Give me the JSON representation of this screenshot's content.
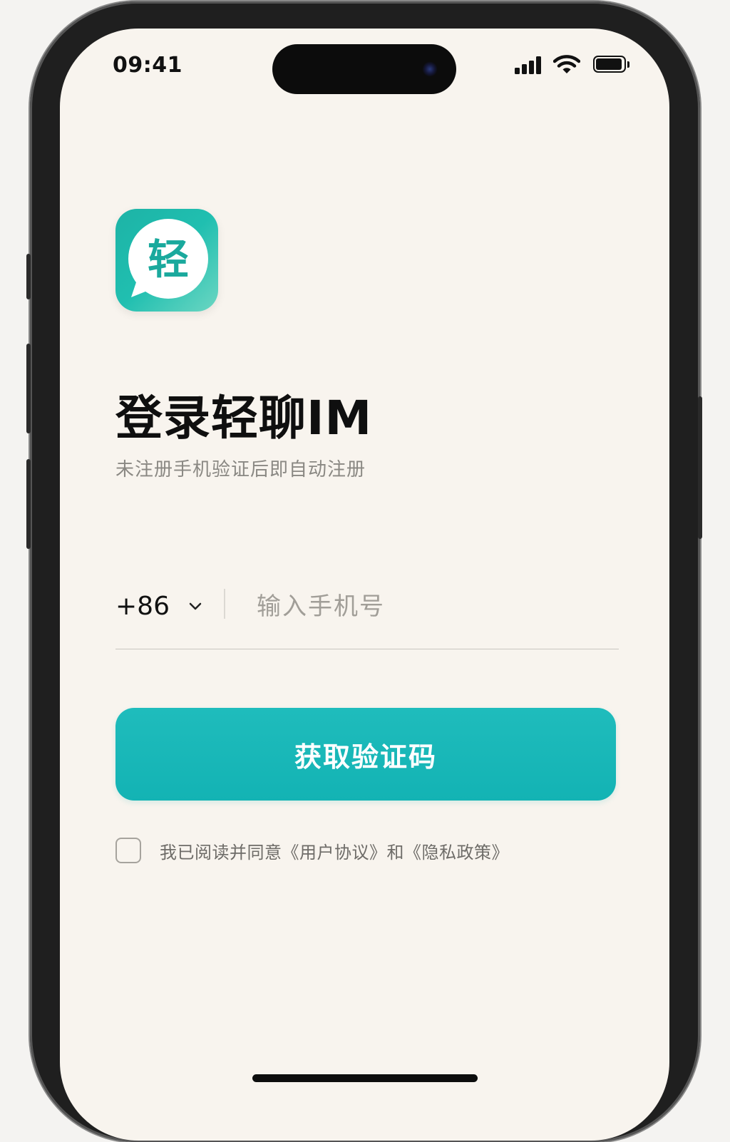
{
  "status_bar": {
    "time": "09:41",
    "signal_icon": "cellular-signal-icon",
    "wifi_icon": "wifi-icon",
    "battery_icon": "battery-icon",
    "battery_level": 0.95
  },
  "app": {
    "icon_glyph": "轻",
    "icon_name": "chat-bubble-logo-icon",
    "icon_colors": [
      "#1db3a6",
      "#6cd6c2"
    ]
  },
  "login": {
    "title": "登录轻聊IM",
    "subtitle": "未注册手机验证后即自动注册",
    "country_code": "+86",
    "phone_placeholder": "输入手机号",
    "phone_value": "",
    "submit_label": "获取验证码",
    "accent_color": "#16b5b6",
    "agreement": {
      "prefix": "我已阅读并同意",
      "user_agreement": "《用户协议》",
      "conjunction": "和",
      "privacy_policy": "《隐私政策》",
      "checked": false
    }
  }
}
